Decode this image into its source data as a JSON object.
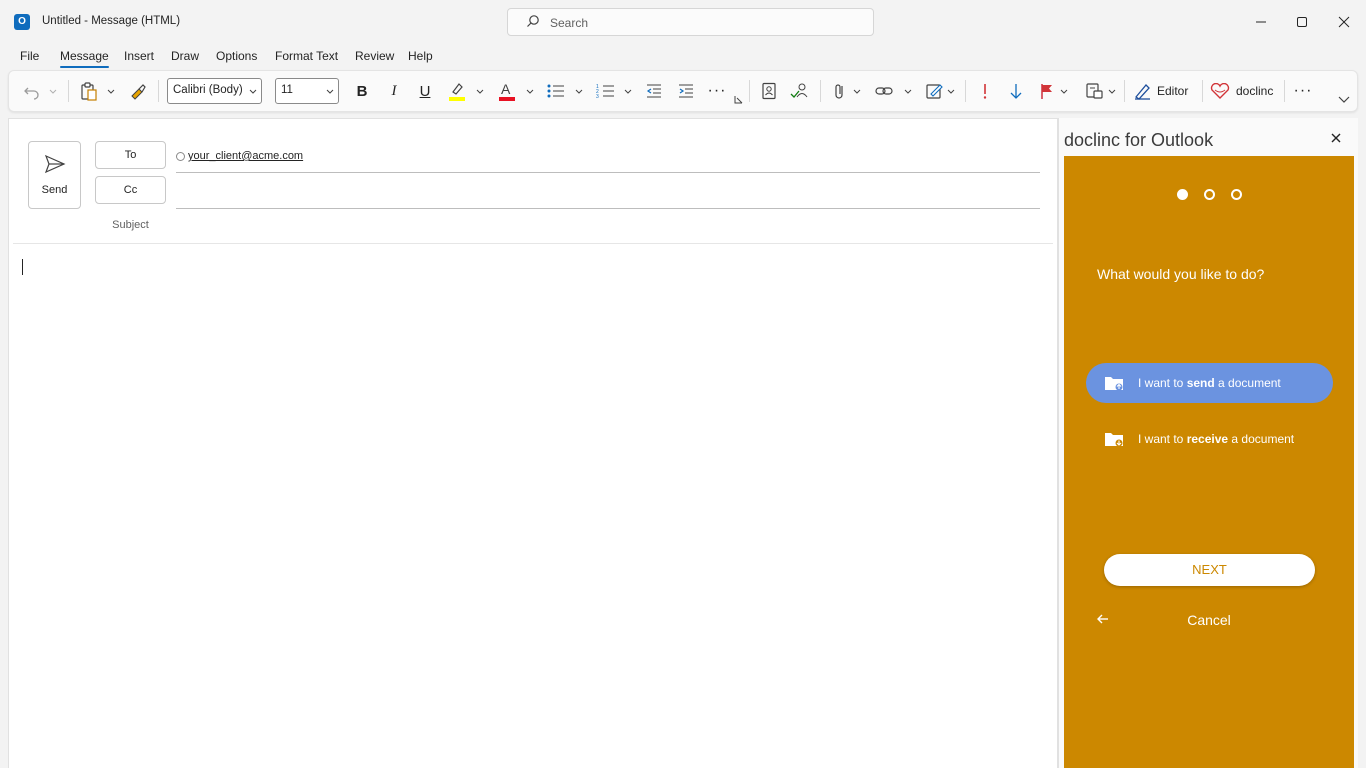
{
  "window": {
    "title": "Untitled  -  Message (HTML)",
    "search_placeholder": "Search"
  },
  "menu": {
    "tabs": [
      "File",
      "Message",
      "Insert",
      "Draw",
      "Options",
      "Format Text",
      "Review",
      "Help"
    ],
    "active_tab": "Message"
  },
  "ribbon": {
    "font_name": "Calibri (Body)",
    "font_size": "11",
    "editor_label": "Editor",
    "doclinc_label": "doclinc",
    "highlight_color": "#ffff00",
    "font_color": "#e81123"
  },
  "compose": {
    "send_label": "Send",
    "to_label": "To",
    "cc_label": "Cc",
    "subject_label": "Subject",
    "to_recipient": "your_client@acme.com"
  },
  "pane": {
    "title": "doclinc for Outlook",
    "accent_color": "#cc8800",
    "steps_total": 3,
    "current_step": 1,
    "question": "What would you like to do?",
    "options": [
      {
        "prefix": "I want to ",
        "bold": "send",
        "suffix": " a document",
        "selected": true
      },
      {
        "prefix": "I want to ",
        "bold": "receive",
        "suffix": " a document",
        "selected": false
      }
    ],
    "next_label": "NEXT",
    "cancel_label": "Cancel"
  }
}
